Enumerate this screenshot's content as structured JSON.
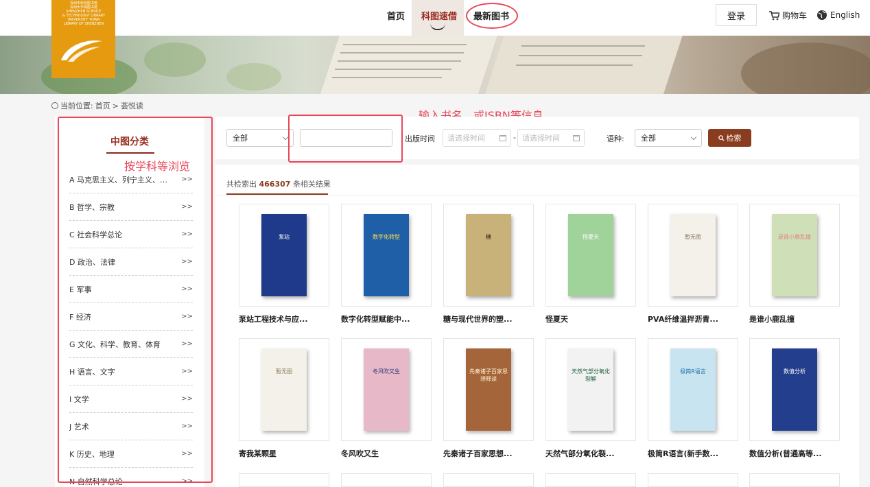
{
  "logo": {
    "lines": [
      "深圳市科技图书馆",
      "深圳大学城图书馆",
      "SHENZHEN SCIENCE",
      "& TECHNOLOGY LIBRARY",
      "UNIVERSITY TOWN",
      "LIBRARY OF SHENZHEN"
    ]
  },
  "nav": {
    "home": "首页",
    "quick_borrow": "科图速借",
    "new_books": "最新图书"
  },
  "header": {
    "login": "登录",
    "cart": "购物车",
    "language": "English"
  },
  "breadcrumb": {
    "prefix": "当前位置:",
    "home": "首页",
    "sep": ">",
    "current": "荟悦读"
  },
  "annotations": {
    "search_hint": "输入书名，或ISBN等信息",
    "browse_hint": "按学科等浏览"
  },
  "sidebar": {
    "title": "中图分类",
    "arrow": ">>",
    "items": [
      "A 马克思主义、列宁主义、毛泽东思想、邓小平理论",
      "B 哲学、宗教",
      "C 社会科学总论",
      "D 政治、法律",
      "E 军事",
      "F 经济",
      "G 文化、科学、教育、体育",
      "H 语言、文字",
      "I 文学",
      "J 艺术",
      "K 历史、地理",
      "N 自然科学总论"
    ]
  },
  "search": {
    "category": "全部",
    "keyword": "",
    "pub_time_label": "出版时间",
    "date_placeholder": "请选择时间",
    "date_sep": "-",
    "language_label": "语种:",
    "language_value": "全部",
    "button": "检索"
  },
  "results": {
    "prefix": "共检索出",
    "count": "466307",
    "suffix": "条相关结果",
    "books": [
      {
        "title": "泵站工程技术与应...",
        "cover_text": "泵站",
        "bg": "#1f3a8a",
        "fg": "#ffffff"
      },
      {
        "title": "数字化转型赋能中...",
        "cover_text": "数字化转型",
        "bg": "#1e5fa8",
        "fg": "#ffe14d"
      },
      {
        "title": "糖与现代世界的塑...",
        "cover_text": "糖",
        "bg": "#c9b27a",
        "fg": "#3a2410"
      },
      {
        "title": "怪夏天",
        "cover_text": "怪夏天",
        "bg": "#9fd39a",
        "fg": "#ffffff"
      },
      {
        "title": "PVA纤维温拌沥青...",
        "cover_text": "暂无图",
        "bg": "#f4f1ea",
        "fg": "#8c7a5a"
      },
      {
        "title": "是谁小鹿乱撞",
        "cover_text": "是谁小鹿乱撞",
        "bg": "#cfe0b8",
        "fg": "#e08080"
      },
      {
        "title": "寄我某颗星",
        "cover_text": "暂无图",
        "bg": "#f4f1ea",
        "fg": "#8c7a5a"
      },
      {
        "title": "冬风吹又生",
        "cover_text": "冬风吹又生",
        "bg": "#e7b9c8",
        "fg": "#2b3a7a"
      },
      {
        "title": "先秦诸子百家思想...",
        "cover_text": "先秦诸子百家思想释读",
        "bg": "#a5653a",
        "fg": "#fff3d6"
      },
      {
        "title": "天然气部分氧化裂...",
        "cover_text": "天然气部分氧化裂解",
        "bg": "#f2f2f2",
        "fg": "#1a5f3a"
      },
      {
        "title": "极简R语言(新手数...",
        "cover_text": "极简R语言",
        "bg": "#c8e4f1",
        "fg": "#1c6fa8"
      },
      {
        "title": "数值分析(普通高等...",
        "cover_text": "数值分析",
        "bg": "#233e8c",
        "fg": "#ffffff"
      }
    ]
  }
}
